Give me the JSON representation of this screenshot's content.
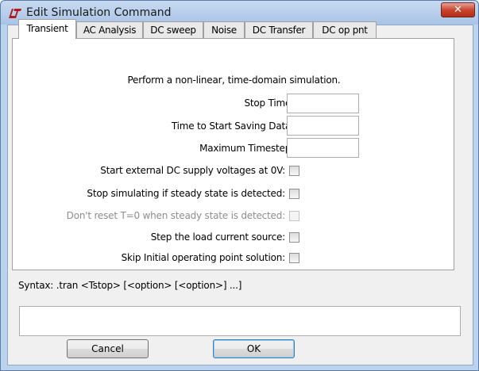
{
  "window": {
    "title": "Edit Simulation Command",
    "close_label": "✕"
  },
  "tabs": [
    {
      "label": "Transient",
      "active": true
    },
    {
      "label": "AC Analysis",
      "active": false
    },
    {
      "label": "DC sweep",
      "active": false
    },
    {
      "label": "Noise",
      "active": false
    },
    {
      "label": "DC Transfer",
      "active": false
    },
    {
      "label": "DC op pnt",
      "active": false
    }
  ],
  "transient": {
    "description": "Perform a non-linear, time-domain simulation.",
    "fields": [
      {
        "label": "Stop Time:",
        "value": ""
      },
      {
        "label": "Time to Start Saving Data:",
        "value": ""
      },
      {
        "label": "Maximum Timestep:",
        "value": ""
      }
    ],
    "options": [
      {
        "label": "Start external DC supply voltages at 0V:",
        "checked": false,
        "enabled": true
      },
      {
        "label": "Stop simulating if steady state is detected:",
        "checked": false,
        "enabled": true
      },
      {
        "label": "Don't reset T=0 when steady state is detected:",
        "checked": false,
        "enabled": false
      },
      {
        "label": "Step the load current source:",
        "checked": false,
        "enabled": true
      },
      {
        "label": "Skip Initial operating point solution:",
        "checked": false,
        "enabled": true
      }
    ]
  },
  "syntax": "Syntax:  .tran <Tstop> [<option> [<option>] ...]",
  "command_text": "",
  "buttons": {
    "cancel": "Cancel",
    "ok": "OK"
  },
  "colors": {
    "title_bar": "#bcd3ee",
    "close_button": "#c9452f",
    "panel_bg": "#ffffff",
    "dialog_bg": "#f0f0f0"
  }
}
